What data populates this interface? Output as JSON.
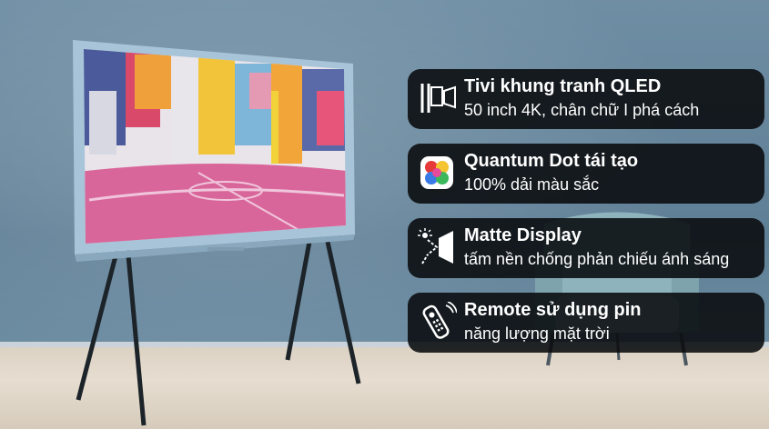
{
  "colors": {
    "wall": "#6f8ea4",
    "floor": "#e0d7c9",
    "card_background": "#0a0c0e",
    "card_text": "#ffffff",
    "tv_frame": "#a8c4d8",
    "tv_legs": "#1c2329"
  },
  "features": [
    {
      "icon": "frame-stand-icon",
      "title": "Tivi khung tranh QLED",
      "subtitle": "50 inch 4K, chân chữ I phá cách"
    },
    {
      "icon": "quantum-dot-color-icon",
      "title": "Quantum Dot tái tạo",
      "subtitle": "100% dải màu sắc"
    },
    {
      "icon": "matte-display-icon",
      "title": "Matte Display",
      "subtitle": "tấm nền chống phản chiếu ánh sáng"
    },
    {
      "icon": "solar-remote-icon",
      "title": "Remote sử dụng pin",
      "subtitle": "năng lượng mặt trời"
    }
  ]
}
